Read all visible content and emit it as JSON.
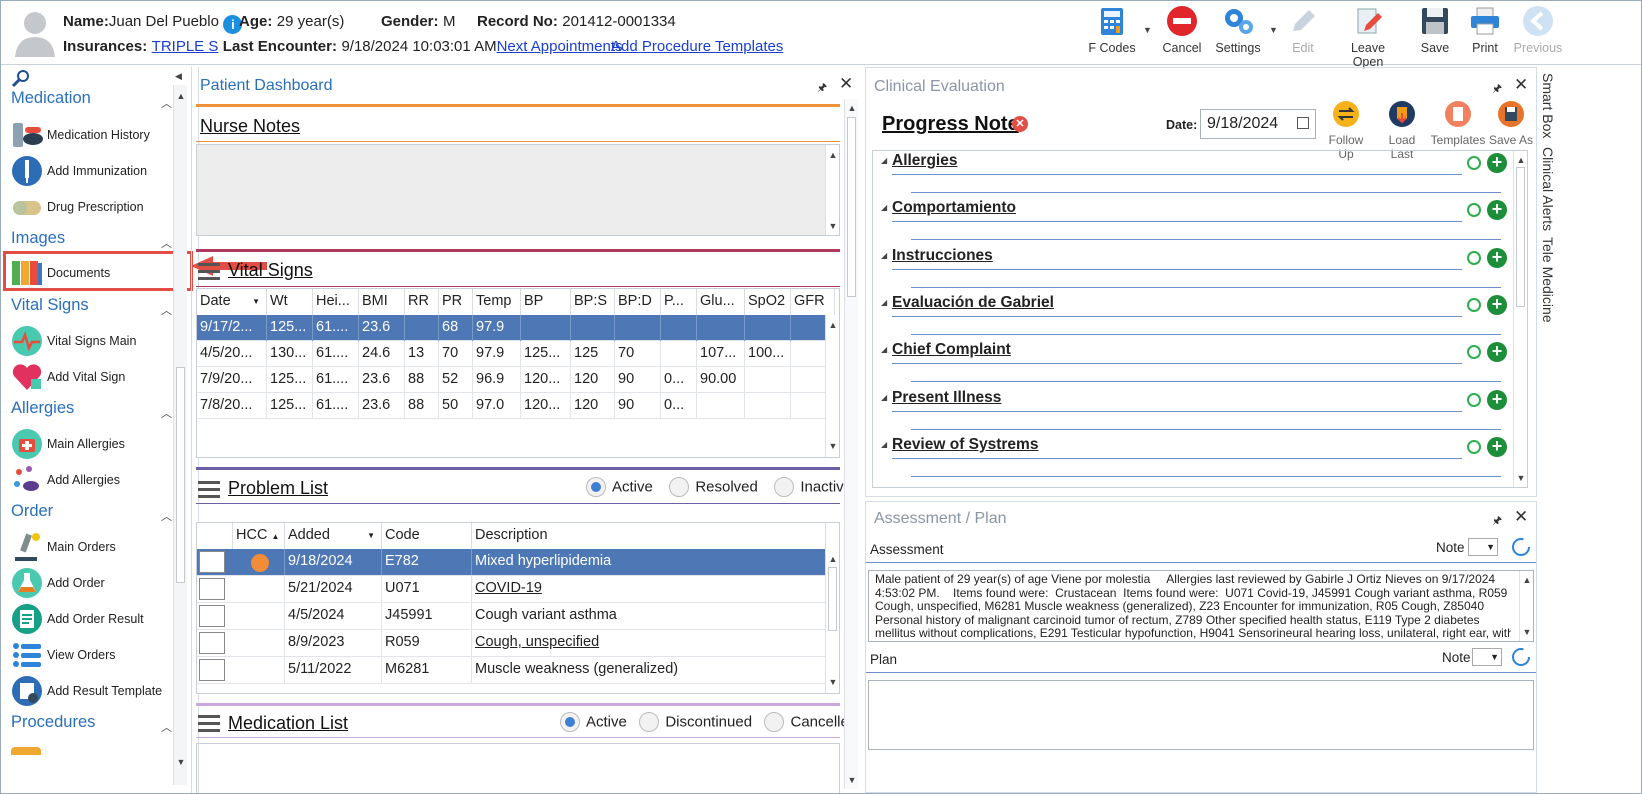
{
  "header": {
    "name_label": "Name:",
    "name_value": "Juan Del Pueblo",
    "age_label": "Age:",
    "age_value": "29 year(s)",
    "gender_label": "Gender:",
    "gender_value": "M",
    "record_label": "Record No:",
    "record_value": "201412-0001334",
    "insurances_label": "Insurances:",
    "insurances_value": "TRIPLE S",
    "last_encounter_label": "Last Encounter:",
    "last_encounter_value": "9/18/2024 10:03:01 AM",
    "next_appointments": "Next Appointments",
    "add_procedure_templates": "Add Procedure Templates"
  },
  "toolbar": {
    "fcodes": "F Codes",
    "cancel": "Cancel",
    "settings": "Settings",
    "edit": "Edit",
    "leave_open": "Leave Open",
    "save": "Save",
    "print": "Print",
    "previous": "Previous"
  },
  "sidebar": {
    "medication": "Medication",
    "medication_history": "Medication History",
    "add_immunization": "Add Immunization",
    "drug_prescription": "Drug Prescription",
    "images": "Images",
    "documents": "Documents",
    "vital_signs": "Vital Signs",
    "vital_signs_main": "Vital Signs Main",
    "add_vital_sign": "Add Vital Sign",
    "allergies": "Allergies",
    "main_allergies": "Main Allergies",
    "add_allergies": "Add Allergies",
    "order": "Order",
    "main_orders": "Main Orders",
    "add_order": "Add Order",
    "add_order_result": "Add Order Result",
    "view_orders": "View Orders",
    "add_result_template": "Add Result Template",
    "procedures": "Procedures"
  },
  "dashboard": {
    "title": "Patient Dashboard",
    "nurse_notes": "Nurse Notes",
    "vital_signs": "Vital Signs",
    "vitals_headers": [
      "Date",
      "Wt",
      "Hei...",
      "BMI",
      "RR",
      "PR",
      "Temp",
      "BP",
      "BP:S",
      "BP:D",
      "P...",
      "Glu...",
      "SpO2",
      "GFR"
    ],
    "vitals_rows": [
      [
        "9/17/2...",
        "125...",
        "61....",
        "23.6",
        "",
        "68",
        "97.9",
        "",
        "",
        "",
        "",
        "",
        "",
        ""
      ],
      [
        "4/5/20...",
        "130...",
        "61....",
        "24.6",
        "13",
        "70",
        "97.9",
        "125...",
        "125",
        "70",
        "",
        "107...",
        "100...",
        ""
      ],
      [
        "7/9/20...",
        "125...",
        "61....",
        "23.6",
        "88",
        "52",
        "96.9",
        "120...",
        "120",
        "90",
        "0...",
        "90.00",
        "",
        ""
      ],
      [
        "7/8/20...",
        "125...",
        "61....",
        "23.6",
        "88",
        "50",
        "97.0",
        "120...",
        "120",
        "90",
        "0...",
        "",
        "",
        ""
      ]
    ],
    "problem_list": "Problem List",
    "problem_filter": {
      "active": "Active",
      "resolved": "Resolved",
      "inactive": "Inactive"
    },
    "problem_headers": [
      "HCC",
      "Added",
      "Code",
      "Description"
    ],
    "problem_rows": [
      {
        "added": "9/18/2024",
        "code": "E782",
        "desc": "Mixed hyperlipidemia"
      },
      {
        "added": "5/21/2024",
        "code": "U071",
        "desc": "COVID-19"
      },
      {
        "added": "4/5/2024",
        "code": "J45991",
        "desc": "Cough variant asthma"
      },
      {
        "added": "8/9/2023",
        "code": "R059",
        "desc": "Cough, unspecified"
      },
      {
        "added": "5/11/2022",
        "code": "M6281",
        "desc": "Muscle weakness (generalized)"
      }
    ],
    "medication_list": "Medication List",
    "med_filter": {
      "active": "Active",
      "discontinued": "Discontinued",
      "cancelled": "Cancelled"
    }
  },
  "clinical": {
    "title": "Clinical Evaluation",
    "progress_note": "Progress Note",
    "date_label": "Date:",
    "date_value": "9/18/2024",
    "follow_up": "Follow Up",
    "load_last": "Load Last",
    "templates": "Templates",
    "save_as": "Save As",
    "sections": [
      "Allergies",
      "Comportamiento",
      "Instrucciones",
      "Evaluación de Gabriel",
      "Chief Complaint",
      "Present Illness",
      "Review of Systrems"
    ]
  },
  "assessment": {
    "title": "Assessment / Plan",
    "assessment_label": "Assessment",
    "note_label": "Note",
    "assessment_lines": [
      "Male patient of 29 year(s) of age Viene por molestia     Allergies last reviewed by Gabirle J Ortiz Nieves on 9/17/2024",
      "4:53:02 PM.    Items found were:  Crustacean  Items found were:  U071 Covid-19, J45991 Cough variant asthma, R059",
      "Cough, unspecified, M6281 Muscle weakness (generalized), Z23 Encounter for immunization, R05 Cough, Z85040",
      "Personal history of malignant carcinoid tumor of rectum, Z789 Other specified health status, E119 Type 2 diabetes",
      "mellitus without complications, E291 Testicular hypofunction, H9041 Sensorineural hearing loss, unilateral, right ear, with"
    ],
    "plan_label": "Plan",
    "plan_note_label": "Note"
  },
  "right_tabs": [
    "Smart Box",
    "Clinical Alerts",
    "Tele Medicine"
  ]
}
